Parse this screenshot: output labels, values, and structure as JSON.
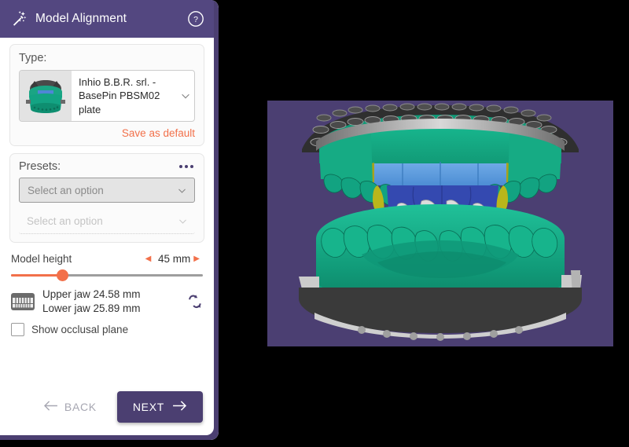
{
  "header": {
    "title": "Model Alignment",
    "wand_icon": "magic-wand-icon",
    "help_icon": "help-circle-icon",
    "bg_color": "#534780"
  },
  "type_section": {
    "label": "Type:",
    "selected_option": "Inhio B.B.R. srl. - BasePin PBSM02 plate",
    "thumbnail_icon": "model-plate-thumbnail",
    "chevron_icon": "chevron-down-icon",
    "save_as_default": "Save as default",
    "save_as_default_color": "#f2704a"
  },
  "presets_section": {
    "label": "Presets:",
    "overflow_icon": "ellipsis-icon",
    "primary_select": {
      "value": "",
      "placeholder": "Select an option",
      "chevron_icon": "chevron-down-icon",
      "disabled": false
    },
    "secondary_select": {
      "value": "",
      "placeholder": "Select an option",
      "chevron_icon": "chevron-down-icon",
      "disabled": true
    }
  },
  "model_height": {
    "label": "Model height",
    "value": "45 mm",
    "decrement_icon": "caret-left-icon",
    "increment_icon": "caret-right-icon",
    "slider_percent": 27,
    "accent_color": "#f2704a"
  },
  "measurements": {
    "jaw_icon": "dental-model-icon",
    "upper_jaw": "Upper jaw 24.58 mm",
    "lower_jaw": "Lower jaw 25.89 mm",
    "reset_icon": "refresh-sync-icon"
  },
  "occlusal": {
    "label": "Show occlusal plane",
    "checked": false
  },
  "footer": {
    "back_label": "BACK",
    "back_icon": "arrow-left-icon",
    "next_label": "NEXT",
    "next_icon": "arrow-right-icon",
    "next_bg_color": "#4b3f71"
  },
  "viewport": {
    "name": "3d-model-viewport",
    "background_color": "#4b3f72",
    "model_colors": {
      "gingiva_green": "#14a07c",
      "plate_dark": "#3a3a3a",
      "plate_metal": "#b9b9b9",
      "blue_block": "#5b9bdd",
      "blue_deep": "#3449b0",
      "tooth_white": "#d9d9d9",
      "margin_yellow": "#bcb81c"
    }
  }
}
